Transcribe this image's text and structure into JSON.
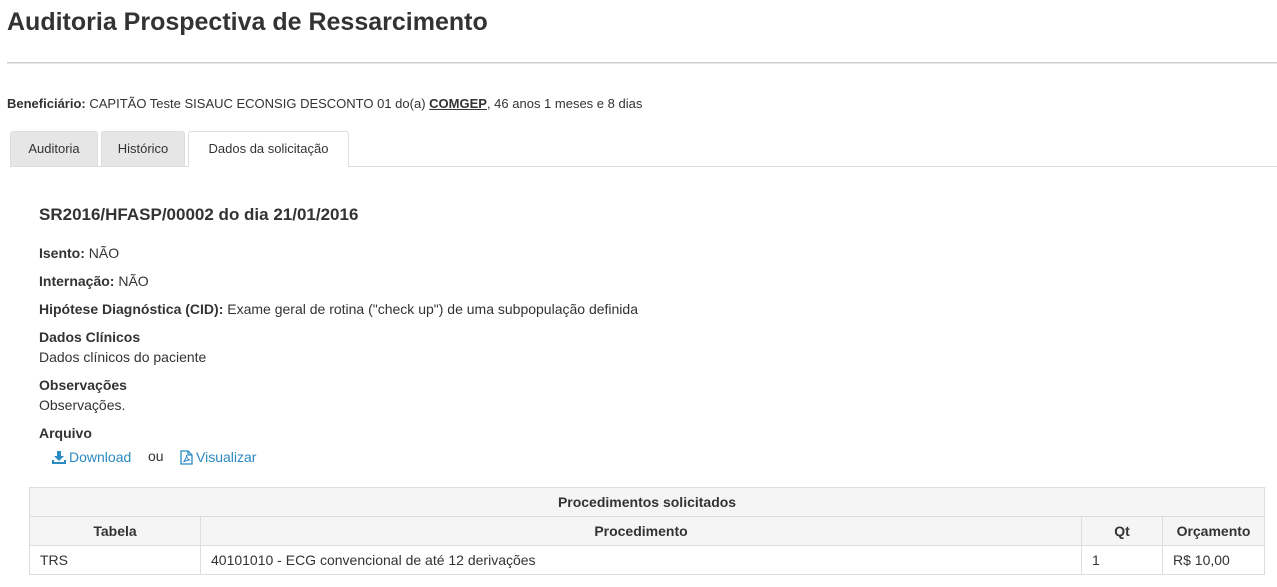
{
  "page": {
    "title": "Auditoria Prospectiva de Ressarcimento"
  },
  "beneficiary": {
    "label": "Beneficiário:",
    "text": " CAPITÃO Teste SISAUC ECONSIG DESCONTO 01 do(a) ",
    "org": "COMGEP",
    "age": ", 46 anos 1 meses e 8 dias"
  },
  "tabs": [
    {
      "label": "Auditoria",
      "active": false
    },
    {
      "label": "Histórico",
      "active": false
    },
    {
      "label": "Dados da solicitação",
      "active": true
    }
  ],
  "request": {
    "title": "SR2016/HFASP/00002 do dia 21/01/2016",
    "isento_label": "Isento:",
    "isento_value": " NÃO",
    "internacao_label": "Internação:",
    "internacao_value": " NÃO",
    "cid_label": "Hipótese Diagnóstica (CID):",
    "cid_value": " Exame geral de rotina (\"check up\") de uma subpopulação definida",
    "clinical_label": "Dados Clínicos",
    "clinical_value": "Dados clínicos do paciente",
    "obs_label": "Observações",
    "obs_value": "Observações.",
    "file_label": "Arquivo",
    "download_label": "Download",
    "or_text": "ou",
    "view_label": "Visualizar"
  },
  "procedures": {
    "caption": "Procedimentos solicitados",
    "headers": [
      "Tabela",
      "Procedimento",
      "Qt",
      "Orçamento"
    ],
    "rows": [
      [
        "TRS",
        "40101010 - ECG convencional de até 12 derivações",
        "1",
        "R$ 10,00"
      ]
    ]
  },
  "colors": {
    "link": "#2a8ac2",
    "tab_inactive": "#e6e6e6",
    "border": "#dddddd"
  },
  "icons": {
    "download": "download-icon",
    "view": "pdf-file-icon"
  }
}
